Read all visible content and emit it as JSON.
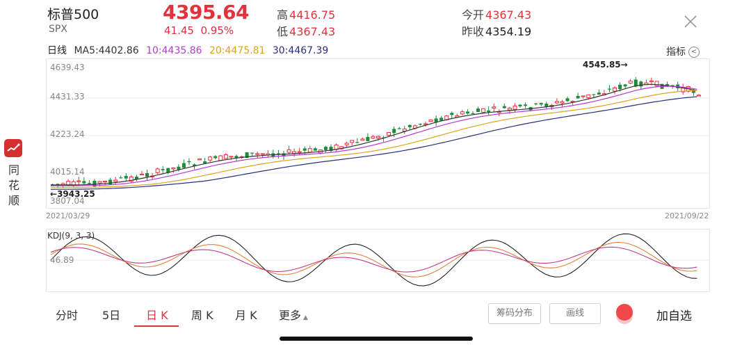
{
  "header": {
    "name": "标普500",
    "code": "SPX",
    "price": "4395.64",
    "change": "41.45",
    "change_pct": "0.95%",
    "high_label": "高",
    "high": "4416.75",
    "low_label": "低",
    "low": "4367.43",
    "open_label": "今开",
    "open": "4367.43",
    "prev_close_label": "昨收",
    "prev_close": "4354.19"
  },
  "ma_row": {
    "label": "日线",
    "ma5": "MA5:4402.86",
    "ma10": "10:4435.86",
    "ma20": "20:4475.81",
    "ma30": "30:4467.39"
  },
  "indicator_label": "指标",
  "app": {
    "name": "同花顺"
  },
  "price_axis": [
    "4639.43",
    "4431.33",
    "4223.24",
    "4015.14",
    "3807.04"
  ],
  "dates": {
    "start": "2021/03/29",
    "end": "2021/09/22"
  },
  "annotations": {
    "high_mark": "4545.85",
    "low_mark": "3943.25"
  },
  "kdj": {
    "label": "KDJ(9, 3, 3)",
    "level": "46.89"
  },
  "tabs": [
    {
      "label": "分时"
    },
    {
      "label": "5日"
    },
    {
      "label": "日 K"
    },
    {
      "label": "周 K"
    },
    {
      "label": "月 K"
    },
    {
      "label": "更多"
    }
  ],
  "buttons": {
    "chip": "筹码分布",
    "draw": "画线",
    "add": "加自选"
  },
  "colors": {
    "up": "#e2323c",
    "down": "#1e8a3c",
    "ma5": "#333333",
    "ma10": "#b43ad0",
    "ma20": "#e0a31a",
    "ma30": "#2a2c80"
  }
}
